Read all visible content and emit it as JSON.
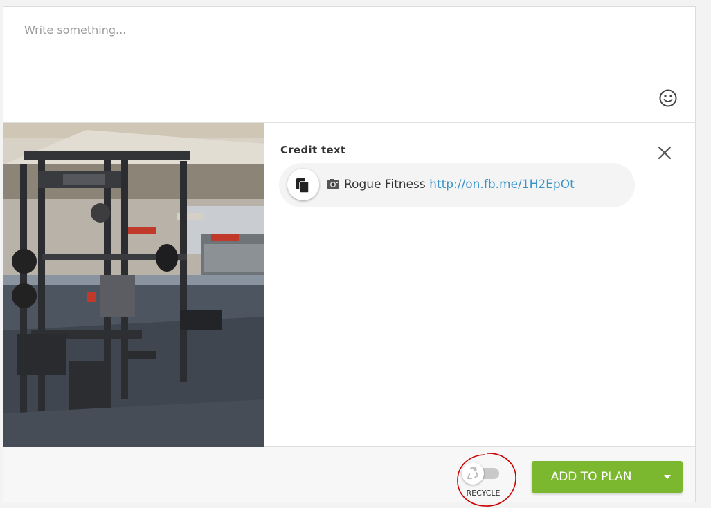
{
  "composer": {
    "placeholder": "Write something...",
    "value": ""
  },
  "credit": {
    "title": "Credit text",
    "name": "Rogue Fitness",
    "link": "http://on.fb.me/1H2EpOt"
  },
  "footer": {
    "recycle_label": "RECYCLE",
    "recycle_on": false,
    "add_button_label": "ADD TO PLAN"
  },
  "icons": [
    "smiley-icon",
    "close-icon",
    "copy-icon",
    "camera-icon",
    "recycle-icon",
    "caret-down-icon"
  ],
  "colors": {
    "accent_green": "#7cb82f",
    "link_blue": "#3a94c8",
    "highlight_red": "#cc0000"
  }
}
